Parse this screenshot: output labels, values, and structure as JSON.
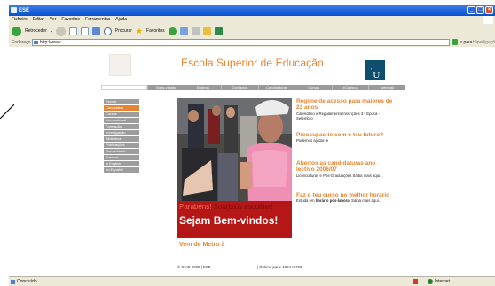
{
  "window": {
    "title": "ESE"
  },
  "menu": [
    "Ficheiro",
    "Editar",
    "Ver",
    "Favoritos",
    "Ferramentas",
    "Ajuda"
  ],
  "toolbar": {
    "back_label": "Retroceder",
    "search_label": "Procurar",
    "favorites_label": "Favoritos"
  },
  "address": {
    "label": "Endereço",
    "url": "http://www.",
    "go_label": "Ir para",
    "links_label": "Hiperligações"
  },
  "site": {
    "title": "Escola Superior de Educação",
    "badge_letter": "U",
    "top_nav": [
      "Boas-vindas",
      "Ensinos",
      "Contactos",
      "Candidaturas",
      "Cursos",
      "eCampus",
      "webmail"
    ],
    "side_nav": [
      "Escola",
      "Candidatos",
      "Cursos",
      "Internacional",
      "Formação",
      "Investigação",
      "Biblioteca",
      "Publicações",
      "Comunidade",
      "Eventos",
      "in English",
      "en Español"
    ],
    "side_nav_active_index": 1,
    "banner": {
      "line1_a": "Parabéns!",
      "line1_b": " Sou(ba)s escolher!",
      "line2": "Sejam Bem-vindos!"
    },
    "metro_link": "Vem de Metro à",
    "news": [
      {
        "heading": "Regime de acesso para maiores de 23 anos",
        "text": "Calendário e Regulamento Inscrições 3 ª Época - Setembro",
        "bold": ""
      },
      {
        "heading": "Preocupas-te com o teu futuro?",
        "text": "Podemos ajudar-te",
        "bold": ""
      },
      {
        "heading": "Abertos as candidaturas ano lectivo 2006/07",
        "text": "Licenciaturas e Pós-Graduações Saiba mais aqui...",
        "bold": ""
      },
      {
        "heading": "Faz o teu curso no melhor horário",
        "text_before": "Estuda em ",
        "bold": "horário pós-laboral",
        "text": " Saiba mais aqui..."
      }
    ],
    "footer_left": "© CIAD 2005 | ESE",
    "footer_right": "| Óptimo para: 1024 X 768"
  },
  "status": {
    "left": "Concluído",
    "zone": "Internet"
  },
  "colors": {
    "accent": "#e8832f",
    "nav_gray": "#9a9a9a",
    "badge_blue": "#0e4f6d",
    "banner_red": "#b51616"
  }
}
